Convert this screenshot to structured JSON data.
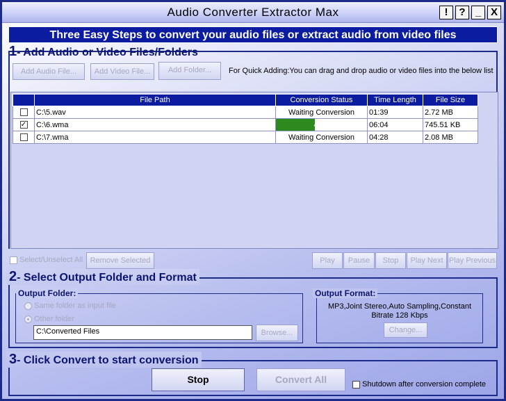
{
  "window": {
    "title": "Audio Converter Extractor Max",
    "buttons": {
      "about": "!",
      "help": "?",
      "minimize": "_",
      "close": "X"
    }
  },
  "banner": "Three Easy Steps to convert your audio files or extract audio from video files",
  "step1": {
    "num": "1",
    "title": "- Add Audio or Video Files/Folders",
    "add_audio": "Add Audio File...",
    "add_video": "Add Video File...",
    "add_folder": "Add Folder...",
    "hint": "For Quick Adding:You can drag and drop audio or video files into the below list"
  },
  "table": {
    "columns": [
      "File Path",
      "Conversion Status",
      "Time Length",
      "File Size"
    ],
    "rows": [
      {
        "checked": false,
        "path": "C:\\5.wav",
        "status": "Waiting Conversion",
        "time": "01:39",
        "size": "2.72 MB"
      },
      {
        "checked": true,
        "path": "C:\\6.wma",
        "status": "43%",
        "progress": 0.43,
        "time": "06:04",
        "size": "745.51 KB"
      },
      {
        "checked": false,
        "path": "C:\\7.wma",
        "status": "Waiting Conversion",
        "time": "04:28",
        "size": "2.08 MB"
      }
    ]
  },
  "list_controls": {
    "select_all": "Select/Unselect All",
    "remove_selected": "Remove Selected",
    "play": "Play",
    "pause": "Pause",
    "stop": "Stop",
    "play_next": "Play Next",
    "play_previous": "Play Previous"
  },
  "step2": {
    "num": "2",
    "title": "- Select Output Folder and Format",
    "output_folder": {
      "label": "Output Folder:",
      "same_folder": "Same folder as input file",
      "other_folder": "Other folder",
      "path": "C:\\Converted Files",
      "browse": "Browse..."
    },
    "output_format": {
      "label": "Output Format:",
      "line1": "MP3,Joint Stereo,Auto Sampling,Constant",
      "line2": "Bitrate 128 Kbps",
      "change": "Change..."
    }
  },
  "step3": {
    "num": "3",
    "title": "- Click Convert to start conversion",
    "stop": "Stop",
    "convert_all": "Convert All",
    "shutdown": "Shutdown after conversion complete"
  }
}
